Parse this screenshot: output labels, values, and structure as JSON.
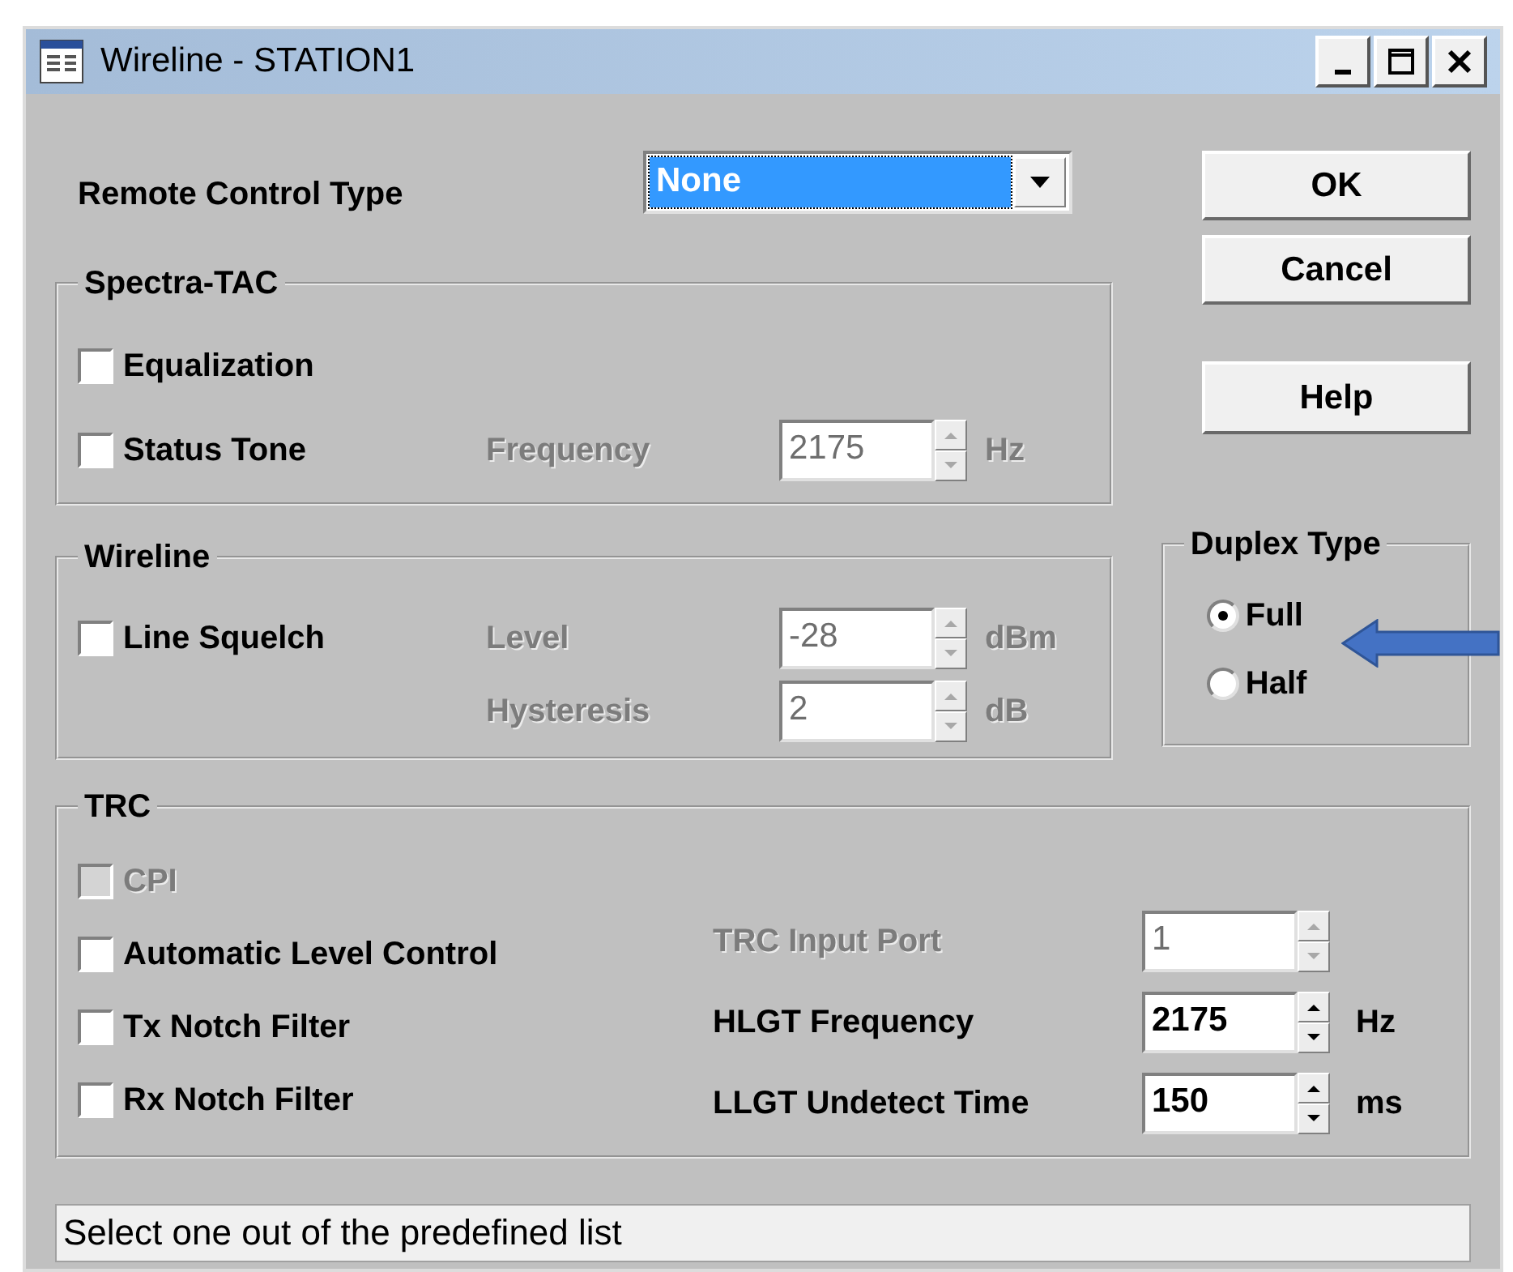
{
  "window": {
    "title": "Wireline - STATION1"
  },
  "remote_control": {
    "label": "Remote Control Type",
    "value": "None"
  },
  "buttons": [
    "OK",
    "Cancel",
    "Help"
  ],
  "spectra_tac": {
    "title": "Spectra-TAC",
    "rows": [
      {
        "checkbox": {
          "label": "Equalization",
          "checked": false,
          "disabled": false
        }
      },
      {
        "checkbox": {
          "label": "Status Tone",
          "checked": false,
          "disabled": false
        },
        "field": {
          "label": "Frequency",
          "value": "2175",
          "unit": "Hz",
          "disabled": true
        }
      }
    ]
  },
  "wireline": {
    "title": "Wireline",
    "rows": [
      {
        "checkbox": {
          "label": "Line Squelch",
          "checked": false,
          "disabled": false
        },
        "field": {
          "label": "Level",
          "value": "-28",
          "unit": "dBm",
          "disabled": true
        }
      },
      {
        "field": {
          "label": "Hysteresis",
          "value": "2",
          "unit": "dB",
          "disabled": true
        }
      }
    ]
  },
  "duplex": {
    "title": "Duplex Type",
    "options": [
      {
        "label": "Full",
        "selected": true
      },
      {
        "label": "Half",
        "selected": false
      }
    ]
  },
  "trc": {
    "title": "TRC",
    "checkboxes": [
      {
        "label": "CPI",
        "checked": false,
        "disabled": true
      },
      {
        "label": "Automatic Level Control",
        "checked": false,
        "disabled": false
      },
      {
        "label": "Tx Notch Filter",
        "checked": false,
        "disabled": false
      },
      {
        "label": "Rx Notch Filter",
        "checked": false,
        "disabled": false
      }
    ],
    "fields": [
      {
        "label": "TRC Input Port",
        "value": "1",
        "disabled": true
      },
      {
        "label": "HLGT Frequency",
        "value": "2175",
        "unit": "Hz",
        "disabled": false
      },
      {
        "label": "LLGT Undetect Time",
        "value": "150",
        "unit": "ms",
        "disabled": false
      }
    ]
  },
  "status_bar": {
    "text": "Select one out of the predefined list"
  }
}
